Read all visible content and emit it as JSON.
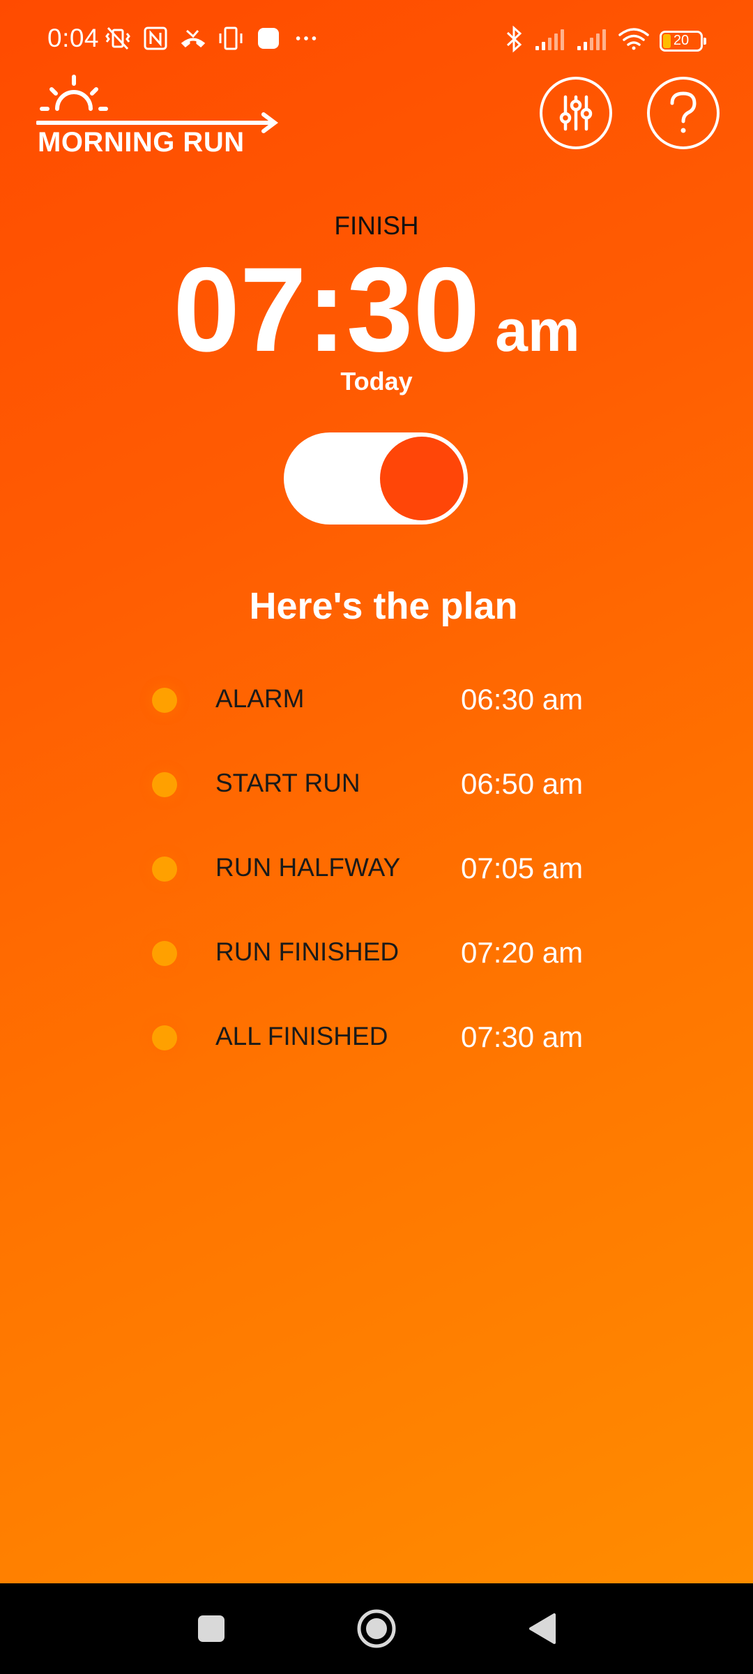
{
  "status_bar": {
    "time": "0:04",
    "battery": "20",
    "battery_level": 0.2
  },
  "header": {
    "logo_text": "MORNING RUN"
  },
  "finish": {
    "label": "FINISH",
    "time": "07:30",
    "ampm": "am",
    "day": "Today"
  },
  "toggle": {
    "on": true
  },
  "plan": {
    "title": "Here's the plan",
    "items": [
      {
        "label": "ALARM",
        "time": "06:30 am"
      },
      {
        "label": "START RUN",
        "time": "06:50 am"
      },
      {
        "label": "RUN HALFWAY",
        "time": "07:05 am"
      },
      {
        "label": "RUN FINISHED",
        "time": "07:20 am"
      },
      {
        "label": "ALL FINISHED",
        "time": "07:30 am"
      }
    ]
  },
  "colors": {
    "background_start": "#ff4b00",
    "background_end": "#ff8f00",
    "toggle_knob": "#ff4608",
    "plan_dot": "#ffa000"
  },
  "icons": {
    "settings": "sliders-icon",
    "help": "question-mark-icon",
    "logo": "sunrise-arrow-icon"
  }
}
